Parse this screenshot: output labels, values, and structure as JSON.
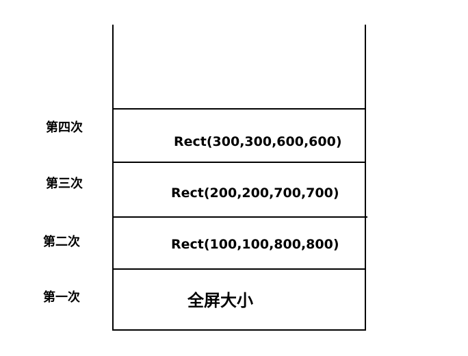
{
  "rows": [
    {
      "step": "第四次",
      "region": "Rect(300,300,600,600)"
    },
    {
      "step": "第三次",
      "region": "Rect(200,200,700,700)"
    },
    {
      "step": "第二次",
      "region": "Rect(100,100,800,800)"
    },
    {
      "step": "第一次",
      "region": "全屏大小"
    }
  ]
}
